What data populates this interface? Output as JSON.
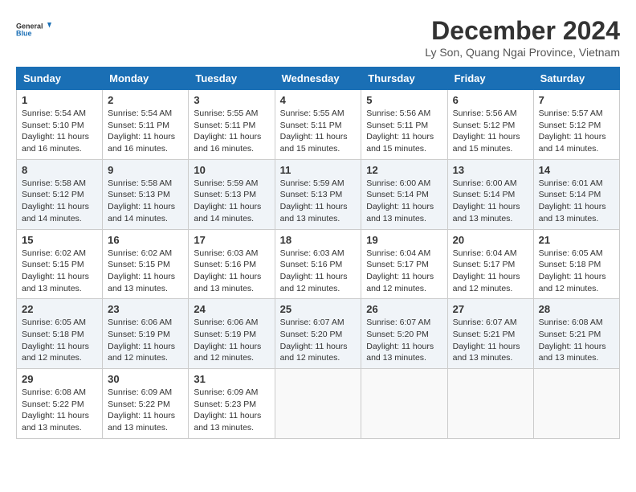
{
  "header": {
    "logo_line1": "General",
    "logo_line2": "Blue",
    "title": "December 2024",
    "subtitle": "Ly Son, Quang Ngai Province, Vietnam"
  },
  "calendar": {
    "weekdays": [
      "Sunday",
      "Monday",
      "Tuesday",
      "Wednesday",
      "Thursday",
      "Friday",
      "Saturday"
    ],
    "weeks": [
      [
        {
          "day": "1",
          "sunrise": "5:54 AM",
          "sunset": "5:10 PM",
          "daylight": "11 hours and 16 minutes."
        },
        {
          "day": "2",
          "sunrise": "5:54 AM",
          "sunset": "5:11 PM",
          "daylight": "11 hours and 16 minutes."
        },
        {
          "day": "3",
          "sunrise": "5:55 AM",
          "sunset": "5:11 PM",
          "daylight": "11 hours and 16 minutes."
        },
        {
          "day": "4",
          "sunrise": "5:55 AM",
          "sunset": "5:11 PM",
          "daylight": "11 hours and 15 minutes."
        },
        {
          "day": "5",
          "sunrise": "5:56 AM",
          "sunset": "5:11 PM",
          "daylight": "11 hours and 15 minutes."
        },
        {
          "day": "6",
          "sunrise": "5:56 AM",
          "sunset": "5:12 PM",
          "daylight": "11 hours and 15 minutes."
        },
        {
          "day": "7",
          "sunrise": "5:57 AM",
          "sunset": "5:12 PM",
          "daylight": "11 hours and 14 minutes."
        }
      ],
      [
        {
          "day": "8",
          "sunrise": "5:58 AM",
          "sunset": "5:12 PM",
          "daylight": "11 hours and 14 minutes."
        },
        {
          "day": "9",
          "sunrise": "5:58 AM",
          "sunset": "5:13 PM",
          "daylight": "11 hours and 14 minutes."
        },
        {
          "day": "10",
          "sunrise": "5:59 AM",
          "sunset": "5:13 PM",
          "daylight": "11 hours and 14 minutes."
        },
        {
          "day": "11",
          "sunrise": "5:59 AM",
          "sunset": "5:13 PM",
          "daylight": "11 hours and 13 minutes."
        },
        {
          "day": "12",
          "sunrise": "6:00 AM",
          "sunset": "5:14 PM",
          "daylight": "11 hours and 13 minutes."
        },
        {
          "day": "13",
          "sunrise": "6:00 AM",
          "sunset": "5:14 PM",
          "daylight": "11 hours and 13 minutes."
        },
        {
          "day": "14",
          "sunrise": "6:01 AM",
          "sunset": "5:14 PM",
          "daylight": "11 hours and 13 minutes."
        }
      ],
      [
        {
          "day": "15",
          "sunrise": "6:02 AM",
          "sunset": "5:15 PM",
          "daylight": "11 hours and 13 minutes."
        },
        {
          "day": "16",
          "sunrise": "6:02 AM",
          "sunset": "5:15 PM",
          "daylight": "11 hours and 13 minutes."
        },
        {
          "day": "17",
          "sunrise": "6:03 AM",
          "sunset": "5:16 PM",
          "daylight": "11 hours and 13 minutes."
        },
        {
          "day": "18",
          "sunrise": "6:03 AM",
          "sunset": "5:16 PM",
          "daylight": "11 hours and 12 minutes."
        },
        {
          "day": "19",
          "sunrise": "6:04 AM",
          "sunset": "5:17 PM",
          "daylight": "11 hours and 12 minutes."
        },
        {
          "day": "20",
          "sunrise": "6:04 AM",
          "sunset": "5:17 PM",
          "daylight": "11 hours and 12 minutes."
        },
        {
          "day": "21",
          "sunrise": "6:05 AM",
          "sunset": "5:18 PM",
          "daylight": "11 hours and 12 minutes."
        }
      ],
      [
        {
          "day": "22",
          "sunrise": "6:05 AM",
          "sunset": "5:18 PM",
          "daylight": "11 hours and 12 minutes."
        },
        {
          "day": "23",
          "sunrise": "6:06 AM",
          "sunset": "5:19 PM",
          "daylight": "11 hours and 12 minutes."
        },
        {
          "day": "24",
          "sunrise": "6:06 AM",
          "sunset": "5:19 PM",
          "daylight": "11 hours and 12 minutes."
        },
        {
          "day": "25",
          "sunrise": "6:07 AM",
          "sunset": "5:20 PM",
          "daylight": "11 hours and 12 minutes."
        },
        {
          "day": "26",
          "sunrise": "6:07 AM",
          "sunset": "5:20 PM",
          "daylight": "11 hours and 13 minutes."
        },
        {
          "day": "27",
          "sunrise": "6:07 AM",
          "sunset": "5:21 PM",
          "daylight": "11 hours and 13 minutes."
        },
        {
          "day": "28",
          "sunrise": "6:08 AM",
          "sunset": "5:21 PM",
          "daylight": "11 hours and 13 minutes."
        }
      ],
      [
        {
          "day": "29",
          "sunrise": "6:08 AM",
          "sunset": "5:22 PM",
          "daylight": "11 hours and 13 minutes."
        },
        {
          "day": "30",
          "sunrise": "6:09 AM",
          "sunset": "5:22 PM",
          "daylight": "11 hours and 13 minutes."
        },
        {
          "day": "31",
          "sunrise": "6:09 AM",
          "sunset": "5:23 PM",
          "daylight": "11 hours and 13 minutes."
        },
        null,
        null,
        null,
        null
      ]
    ]
  }
}
